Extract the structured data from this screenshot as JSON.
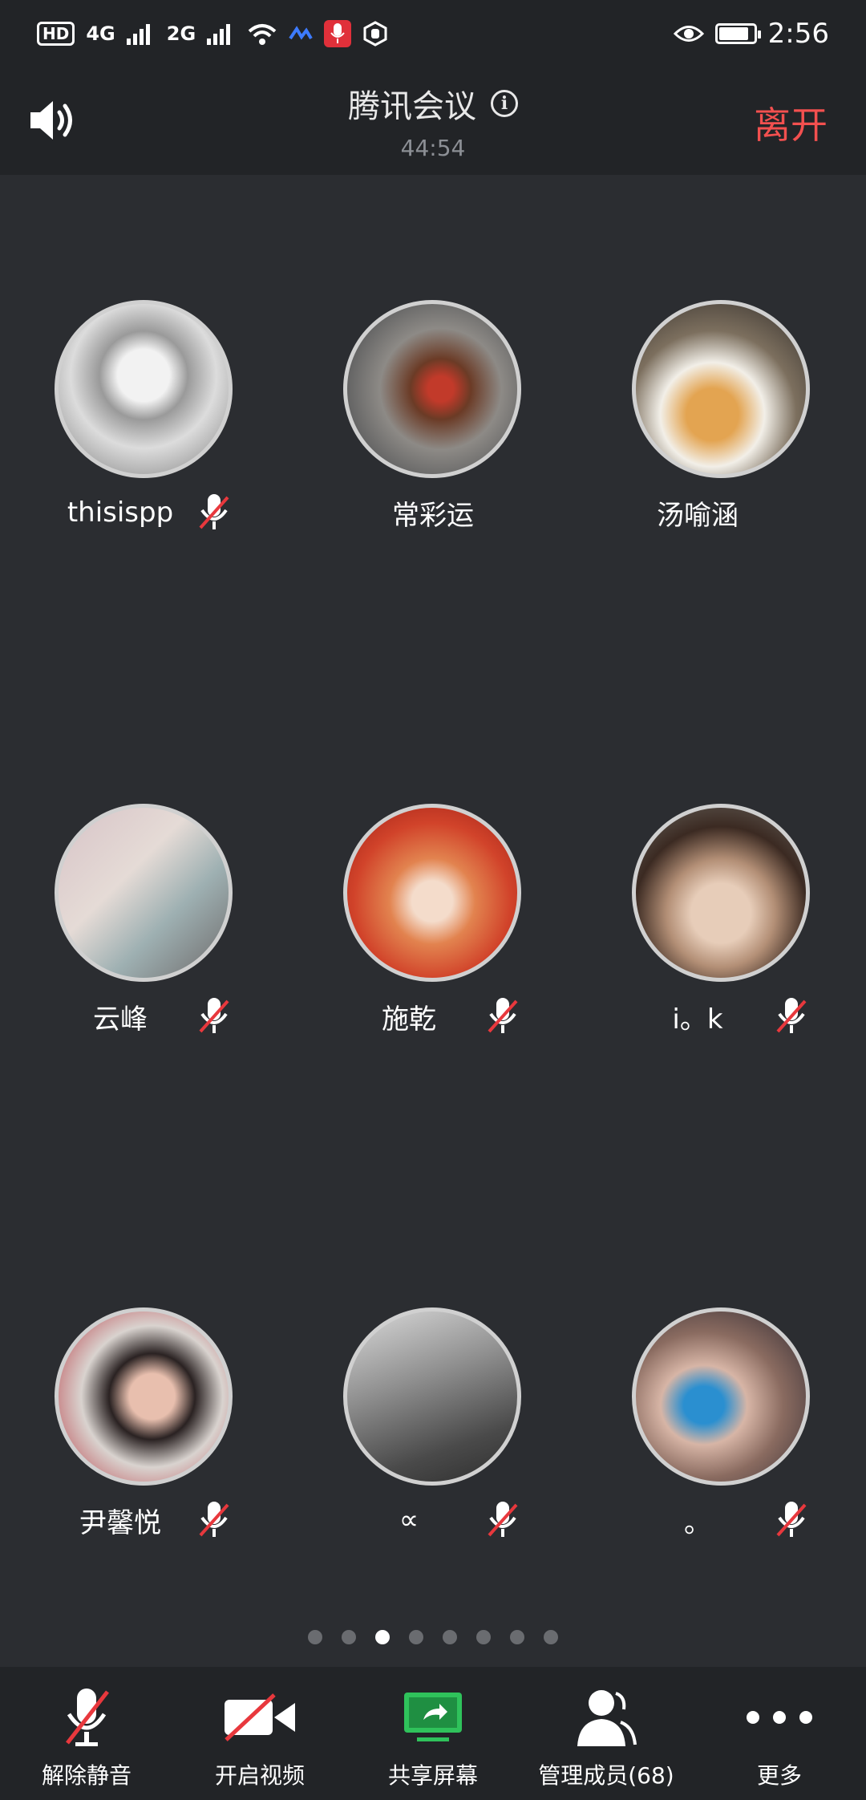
{
  "status_bar": {
    "hd_label": "HD",
    "network_4g": "4G",
    "network_2g": "2G",
    "time": "2:56"
  },
  "header": {
    "title": "腾讯会议",
    "timer": "44:54",
    "leave_label": "离开"
  },
  "participants": [
    {
      "name": "thisispp",
      "muted": true
    },
    {
      "name": "常彩运",
      "muted": false
    },
    {
      "name": "汤喻涵",
      "muted": false
    },
    {
      "name": "云峰",
      "muted": true
    },
    {
      "name": "施乾",
      "muted": true
    },
    {
      "name": "i。k",
      "muted": true
    },
    {
      "name": "尹馨悦",
      "muted": true
    },
    {
      "name": "∝",
      "muted": true
    },
    {
      "name": "。",
      "muted": true
    }
  ],
  "pagination": {
    "total": 8,
    "active": 3
  },
  "toolbar": {
    "unmute_label": "解除静音",
    "video_label": "开启视频",
    "share_label": "共享屏幕",
    "members_label": "管理成员(68)",
    "more_label": "更多"
  },
  "colors": {
    "background": "#2b2d31",
    "bar": "#222427",
    "leave": "#f3504f",
    "mute_slash": "#e8383d",
    "share_green": "#2fc25b"
  }
}
